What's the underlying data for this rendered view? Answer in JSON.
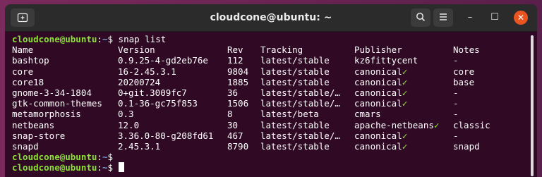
{
  "window": {
    "title": "cloudcone@ubuntu: ~",
    "new_tab_icon": "terminal-new-tab-icon",
    "search_icon": "search-icon",
    "menu_icon": "hamburger-menu-icon",
    "minimize_label": "–",
    "maximize_label": "☐",
    "close_label": "✕"
  },
  "terminal": {
    "prompt_user": "cloudcone@ubuntu",
    "prompt_sep": ":",
    "prompt_path": "~",
    "prompt_symbol": "$ ",
    "command": "snap list",
    "headers": [
      "Name",
      "Version",
      "Rev",
      "Tracking",
      "Publisher",
      "Notes"
    ],
    "rows": [
      [
        "bashtop",
        "0.9.25-4-gd2eb76e",
        "112",
        "latest/stable",
        "kz6fittycent",
        "",
        "-"
      ],
      [
        "core",
        "16-2.45.3.1",
        "9804",
        "latest/stable",
        "canonical",
        "✓",
        "core"
      ],
      [
        "core18",
        "20200724",
        "1885",
        "latest/stable",
        "canonical",
        "✓",
        "base"
      ],
      [
        "gnome-3-34-1804",
        "0+git.3009fc7",
        "36",
        "latest/stable/…",
        "canonical",
        "✓",
        "-"
      ],
      [
        "gtk-common-themes",
        "0.1-36-gc75f853",
        "1506",
        "latest/stable/…",
        "canonical",
        "✓",
        "-"
      ],
      [
        "metamorphosis",
        "0.3",
        "8",
        "latest/beta",
        "cmars",
        "",
        "-"
      ],
      [
        "netbeans",
        "12.0",
        "30",
        "latest/stable",
        "apache-netbeans",
        "✓",
        "classic"
      ],
      [
        "snap-store",
        "3.36.0-80-g208fd61",
        "467",
        "latest/stable/…",
        "canonical",
        "✓",
        "-"
      ],
      [
        "snapd",
        "2.45.3.1",
        "8790",
        "latest/stable",
        "canonical",
        "✓",
        "snapd"
      ]
    ]
  },
  "colors": {
    "terminal_bg": "#300a24",
    "prompt_user": "#8ae234",
    "prompt_path": "#729fcf",
    "close_button": "#e95420"
  }
}
